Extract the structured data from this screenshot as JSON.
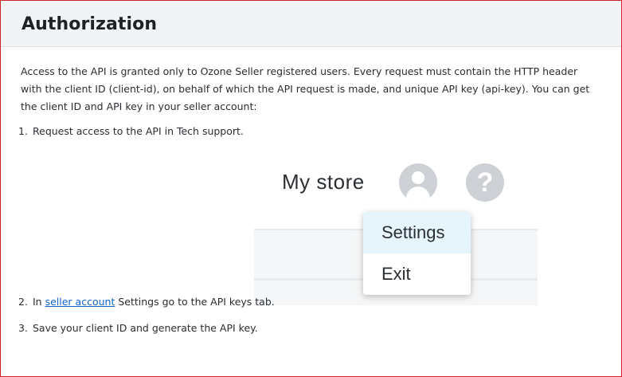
{
  "header": {
    "title": "Authorization"
  },
  "intro": "Access to the API is granted only to Ozone Seller registered users. Every request must contain the HTTP header with the client ID (client-id), on behalf of which the API request is made, and unique API key (api-key). You can get the client ID and API key in your seller account:",
  "steps": [
    {
      "num": "1.",
      "text": "Request access to the API in Tech support."
    },
    {
      "num": "2.",
      "pre": "In",
      "link": "seller account",
      "post": "Settings go to the API keys tab."
    },
    {
      "num": "3.",
      "text": "Save your client ID and generate the API key."
    }
  ],
  "illustration": {
    "store_title": "My store",
    "help_glyph": "?",
    "menu": {
      "items": [
        "Settings",
        "Exit"
      ],
      "active_index": 0
    },
    "icons": [
      "user-avatar-icon",
      "help-icon"
    ]
  },
  "colors": {
    "frame_border": "#d2232a",
    "header_bg": "#f2f3f5",
    "link": "#1464c8",
    "menu_active_bg": "#e6f4fb",
    "icon_gray": "#cdd0d4"
  }
}
